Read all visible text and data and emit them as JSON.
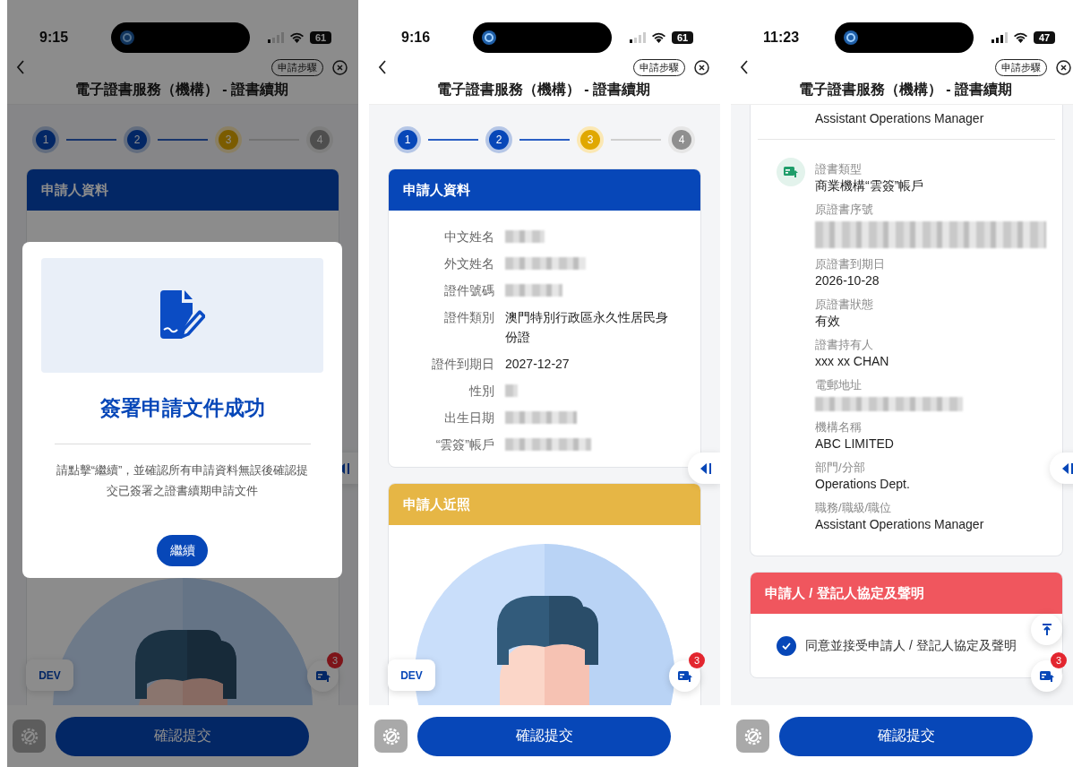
{
  "phones": [
    {
      "status": {
        "time": "9:15",
        "battery": "61"
      },
      "nav": {
        "steps_button": "申請步驟",
        "title": "電子證書服務（機構） - 證書續期"
      },
      "steps": [
        {
          "label": "1",
          "done": true,
          "current": false
        },
        {
          "label": "2",
          "done": true,
          "current": false
        },
        {
          "label": "3",
          "done": false,
          "current": true
        },
        {
          "label": "4",
          "done": false,
          "current": false
        }
      ],
      "sections": [
        {
          "kind": "details",
          "title": "申請人資料"
        },
        {
          "kind": "photo"
        }
      ],
      "dev_badge": "DEV",
      "notification_count": "3",
      "submit_button": "確認提交",
      "dialog": {
        "title": "簽署申請文件成功",
        "message": "請點擊“繼續”，並確認所有申請資料無誤後確認提交已簽署之證書續期申請文件",
        "button": "繼續"
      }
    },
    {
      "status": {
        "time": "9:16",
        "battery": "61"
      },
      "nav": {
        "steps_button": "申請步驟",
        "title": "電子證書服務（機構） - 證書續期"
      },
      "steps": [
        {
          "label": "1",
          "done": true,
          "current": false
        },
        {
          "label": "2",
          "done": true,
          "current": false
        },
        {
          "label": "3",
          "done": false,
          "current": true
        },
        {
          "label": "4",
          "done": false,
          "current": false
        }
      ],
      "sections": [
        {
          "kind": "details",
          "title": "申請人資料",
          "rows": [
            {
              "label": "中文姓名",
              "redacted": true
            },
            {
              "label": "外文姓名",
              "redacted": true
            },
            {
              "label": "證件號碼",
              "redacted": true
            },
            {
              "label": "證件類別",
              "value": "澳門特別行政區永久性居民身份證"
            },
            {
              "label": "證件到期日",
              "value": "2027-12-27"
            },
            {
              "label": "性別",
              "redacted": true
            },
            {
              "label": "出生日期",
              "redacted": true
            },
            {
              "label": "“雲簽”帳戶",
              "redacted": true
            }
          ]
        },
        {
          "kind": "photo",
          "title": "申請人近照"
        }
      ],
      "dev_badge": "DEV",
      "notification_count": "3",
      "submit_button": "確認提交"
    },
    {
      "status": {
        "time": "11:23",
        "battery": "47"
      },
      "nav": {
        "steps_button": "申請步驟",
        "title": "電子證書服務（機構） - 證書續期"
      },
      "sections": [
        {
          "kind": "info",
          "lead": "Assistant Operations Manager",
          "items": [
            {
              "label": "證書類型",
              "value": "商業機構“雲簽”帳戶"
            },
            {
              "label": "原證書序號",
              "redacted": true
            },
            {
              "label": "原證書到期日",
              "value": "2026-10-28"
            },
            {
              "label": "原證書狀態",
              "value": "有效"
            },
            {
              "label": "證書持有人",
              "value": "xxx xx CHAN"
            },
            {
              "label": "電郵地址",
              "redacted": true
            },
            {
              "label": "機構名稱",
              "value": "ABC LIMITED"
            },
            {
              "label": "部門/分部",
              "value": "Operations Dept."
            },
            {
              "label": "職務/職級/職位",
              "value": "Assistant Operations Manager"
            }
          ]
        },
        {
          "kind": "agreement",
          "title": "申請人 / 登記人協定及聲明",
          "checkbox": {
            "label": "同意並接受申請人 / 登記人協定及聲明",
            "checked": true
          }
        }
      ],
      "scroll_top": true,
      "notification_count": "3",
      "submit_button": "確認提交"
    }
  ]
}
